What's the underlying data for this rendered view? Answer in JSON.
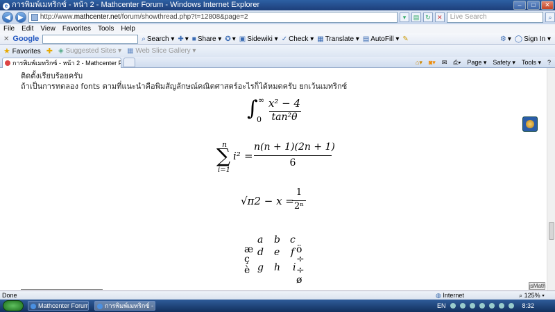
{
  "window": {
    "title": "การพิมพ์เมทริกซ์ - หน้า 2 - Mathcenter Forum - Windows Internet Explorer"
  },
  "address": {
    "protocol": "http://www.",
    "domain": "mathcenter.net",
    "path": "/forum/showthread.php?t=12808&page=2"
  },
  "search": {
    "placeholder": "Live Search"
  },
  "menu": [
    "File",
    "Edit",
    "View",
    "Favorites",
    "Tools",
    "Help"
  ],
  "googlebar": {
    "logo": "Google",
    "items": [
      "Search ▾",
      "Share ▾",
      "Sidewiki ▾",
      "Check ▾",
      "Translate ▾",
      "AutoFill ▾"
    ],
    "signin": "Sign In ▾"
  },
  "favbar": {
    "favorites": "Favorites",
    "suggested": "Suggested Sites ▾",
    "webslice": "Web Slice Gallery ▾"
  },
  "tab": {
    "label": "การพิมพ์เมทริกซ์ - หน้า 2 - Mathcenter Forum"
  },
  "commandbar": [
    "Page ▾",
    "Safety ▾",
    "Tools ▾",
    "?"
  ],
  "post": {
    "line1": "ติดตั้งเรียบร้อยครับ",
    "line2": "ถ้าเป็นการทดลอง fonts ตามที่แนะนำคือพิมสัญลักษณ์คณิตศาสตร์อะไรก็ได้หมดครับ ยกเว้นเมทริกซ์"
  },
  "math": {
    "integral": {
      "upper": "∞",
      "lower": "0",
      "numerator": "x² − 4",
      "denominator": "tan²θ"
    },
    "sum": {
      "upper": "n",
      "lower": "i=1",
      "term": "i²",
      "equals": "=",
      "numerator": "n(n + 1)(2n + 1)",
      "denominator": "6"
    },
    "sqrt": {
      "lhs": "√π2 − x =",
      "numerator": "1",
      "denominator": "2ⁿ"
    },
    "matrix": {
      "rows": [
        [
          "",
          "a",
          "b",
          "c"
        ],
        [
          "æ",
          "d",
          "e",
          "f"
        ],
        [
          "ç",
          "g",
          "h",
          "i"
        ],
        [
          "è",
          "",
          "",
          ""
        ]
      ],
      "right": [
        "ö",
        "÷",
        "÷",
        "ø"
      ]
    }
  },
  "jsmath_label": "jsMath",
  "status": {
    "left": "Done",
    "zone": "Internet",
    "zoom": "125%"
  },
  "taskbar": {
    "tasks": [
      "Mathcenter Forum ...",
      "การพิมพ์เมทริกซ์ - หน้..."
    ],
    "lang": "EN",
    "time": "8:32"
  }
}
